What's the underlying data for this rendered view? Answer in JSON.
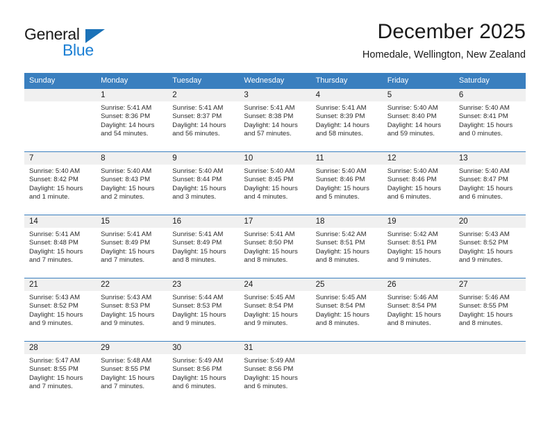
{
  "brand": {
    "name_top": "General",
    "name_bottom": "Blue",
    "accent_color": "#1b7fd4",
    "header_color": "#3a7fbf"
  },
  "header": {
    "title": "December 2025",
    "subtitle": "Homedale, Wellington, New Zealand"
  },
  "calendar": {
    "weekday_headers": [
      "Sunday",
      "Monday",
      "Tuesday",
      "Wednesday",
      "Thursday",
      "Friday",
      "Saturday"
    ],
    "weeks": [
      [
        {
          "day": "",
          "sunrise": "",
          "sunset": "",
          "daylight_line1": "",
          "daylight_line2": ""
        },
        {
          "day": "1",
          "sunrise": "Sunrise: 5:41 AM",
          "sunset": "Sunset: 8:36 PM",
          "daylight_line1": "Daylight: 14 hours",
          "daylight_line2": "and 54 minutes."
        },
        {
          "day": "2",
          "sunrise": "Sunrise: 5:41 AM",
          "sunset": "Sunset: 8:37 PM",
          "daylight_line1": "Daylight: 14 hours",
          "daylight_line2": "and 56 minutes."
        },
        {
          "day": "3",
          "sunrise": "Sunrise: 5:41 AM",
          "sunset": "Sunset: 8:38 PM",
          "daylight_line1": "Daylight: 14 hours",
          "daylight_line2": "and 57 minutes."
        },
        {
          "day": "4",
          "sunrise": "Sunrise: 5:41 AM",
          "sunset": "Sunset: 8:39 PM",
          "daylight_line1": "Daylight: 14 hours",
          "daylight_line2": "and 58 minutes."
        },
        {
          "day": "5",
          "sunrise": "Sunrise: 5:40 AM",
          "sunset": "Sunset: 8:40 PM",
          "daylight_line1": "Daylight: 14 hours",
          "daylight_line2": "and 59 minutes."
        },
        {
          "day": "6",
          "sunrise": "Sunrise: 5:40 AM",
          "sunset": "Sunset: 8:41 PM",
          "daylight_line1": "Daylight: 15 hours",
          "daylight_line2": "and 0 minutes."
        }
      ],
      [
        {
          "day": "7",
          "sunrise": "Sunrise: 5:40 AM",
          "sunset": "Sunset: 8:42 PM",
          "daylight_line1": "Daylight: 15 hours",
          "daylight_line2": "and 1 minute."
        },
        {
          "day": "8",
          "sunrise": "Sunrise: 5:40 AM",
          "sunset": "Sunset: 8:43 PM",
          "daylight_line1": "Daylight: 15 hours",
          "daylight_line2": "and 2 minutes."
        },
        {
          "day": "9",
          "sunrise": "Sunrise: 5:40 AM",
          "sunset": "Sunset: 8:44 PM",
          "daylight_line1": "Daylight: 15 hours",
          "daylight_line2": "and 3 minutes."
        },
        {
          "day": "10",
          "sunrise": "Sunrise: 5:40 AM",
          "sunset": "Sunset: 8:45 PM",
          "daylight_line1": "Daylight: 15 hours",
          "daylight_line2": "and 4 minutes."
        },
        {
          "day": "11",
          "sunrise": "Sunrise: 5:40 AM",
          "sunset": "Sunset: 8:46 PM",
          "daylight_line1": "Daylight: 15 hours",
          "daylight_line2": "and 5 minutes."
        },
        {
          "day": "12",
          "sunrise": "Sunrise: 5:40 AM",
          "sunset": "Sunset: 8:46 PM",
          "daylight_line1": "Daylight: 15 hours",
          "daylight_line2": "and 6 minutes."
        },
        {
          "day": "13",
          "sunrise": "Sunrise: 5:40 AM",
          "sunset": "Sunset: 8:47 PM",
          "daylight_line1": "Daylight: 15 hours",
          "daylight_line2": "and 6 minutes."
        }
      ],
      [
        {
          "day": "14",
          "sunrise": "Sunrise: 5:41 AM",
          "sunset": "Sunset: 8:48 PM",
          "daylight_line1": "Daylight: 15 hours",
          "daylight_line2": "and 7 minutes."
        },
        {
          "day": "15",
          "sunrise": "Sunrise: 5:41 AM",
          "sunset": "Sunset: 8:49 PM",
          "daylight_line1": "Daylight: 15 hours",
          "daylight_line2": "and 7 minutes."
        },
        {
          "day": "16",
          "sunrise": "Sunrise: 5:41 AM",
          "sunset": "Sunset: 8:49 PM",
          "daylight_line1": "Daylight: 15 hours",
          "daylight_line2": "and 8 minutes."
        },
        {
          "day": "17",
          "sunrise": "Sunrise: 5:41 AM",
          "sunset": "Sunset: 8:50 PM",
          "daylight_line1": "Daylight: 15 hours",
          "daylight_line2": "and 8 minutes."
        },
        {
          "day": "18",
          "sunrise": "Sunrise: 5:42 AM",
          "sunset": "Sunset: 8:51 PM",
          "daylight_line1": "Daylight: 15 hours",
          "daylight_line2": "and 8 minutes."
        },
        {
          "day": "19",
          "sunrise": "Sunrise: 5:42 AM",
          "sunset": "Sunset: 8:51 PM",
          "daylight_line1": "Daylight: 15 hours",
          "daylight_line2": "and 9 minutes."
        },
        {
          "day": "20",
          "sunrise": "Sunrise: 5:43 AM",
          "sunset": "Sunset: 8:52 PM",
          "daylight_line1": "Daylight: 15 hours",
          "daylight_line2": "and 9 minutes."
        }
      ],
      [
        {
          "day": "21",
          "sunrise": "Sunrise: 5:43 AM",
          "sunset": "Sunset: 8:52 PM",
          "daylight_line1": "Daylight: 15 hours",
          "daylight_line2": "and 9 minutes."
        },
        {
          "day": "22",
          "sunrise": "Sunrise: 5:43 AM",
          "sunset": "Sunset: 8:53 PM",
          "daylight_line1": "Daylight: 15 hours",
          "daylight_line2": "and 9 minutes."
        },
        {
          "day": "23",
          "sunrise": "Sunrise: 5:44 AM",
          "sunset": "Sunset: 8:53 PM",
          "daylight_line1": "Daylight: 15 hours",
          "daylight_line2": "and 9 minutes."
        },
        {
          "day": "24",
          "sunrise": "Sunrise: 5:45 AM",
          "sunset": "Sunset: 8:54 PM",
          "daylight_line1": "Daylight: 15 hours",
          "daylight_line2": "and 9 minutes."
        },
        {
          "day": "25",
          "sunrise": "Sunrise: 5:45 AM",
          "sunset": "Sunset: 8:54 PM",
          "daylight_line1": "Daylight: 15 hours",
          "daylight_line2": "and 8 minutes."
        },
        {
          "day": "26",
          "sunrise": "Sunrise: 5:46 AM",
          "sunset": "Sunset: 8:54 PM",
          "daylight_line1": "Daylight: 15 hours",
          "daylight_line2": "and 8 minutes."
        },
        {
          "day": "27",
          "sunrise": "Sunrise: 5:46 AM",
          "sunset": "Sunset: 8:55 PM",
          "daylight_line1": "Daylight: 15 hours",
          "daylight_line2": "and 8 minutes."
        }
      ],
      [
        {
          "day": "28",
          "sunrise": "Sunrise: 5:47 AM",
          "sunset": "Sunset: 8:55 PM",
          "daylight_line1": "Daylight: 15 hours",
          "daylight_line2": "and 7 minutes."
        },
        {
          "day": "29",
          "sunrise": "Sunrise: 5:48 AM",
          "sunset": "Sunset: 8:55 PM",
          "daylight_line1": "Daylight: 15 hours",
          "daylight_line2": "and 7 minutes."
        },
        {
          "day": "30",
          "sunrise": "Sunrise: 5:49 AM",
          "sunset": "Sunset: 8:56 PM",
          "daylight_line1": "Daylight: 15 hours",
          "daylight_line2": "and 6 minutes."
        },
        {
          "day": "31",
          "sunrise": "Sunrise: 5:49 AM",
          "sunset": "Sunset: 8:56 PM",
          "daylight_line1": "Daylight: 15 hours",
          "daylight_line2": "and 6 minutes."
        },
        {
          "day": "",
          "sunrise": "",
          "sunset": "",
          "daylight_line1": "",
          "daylight_line2": ""
        },
        {
          "day": "",
          "sunrise": "",
          "sunset": "",
          "daylight_line1": "",
          "daylight_line2": ""
        },
        {
          "day": "",
          "sunrise": "",
          "sunset": "",
          "daylight_line1": "",
          "daylight_line2": ""
        }
      ]
    ]
  }
}
